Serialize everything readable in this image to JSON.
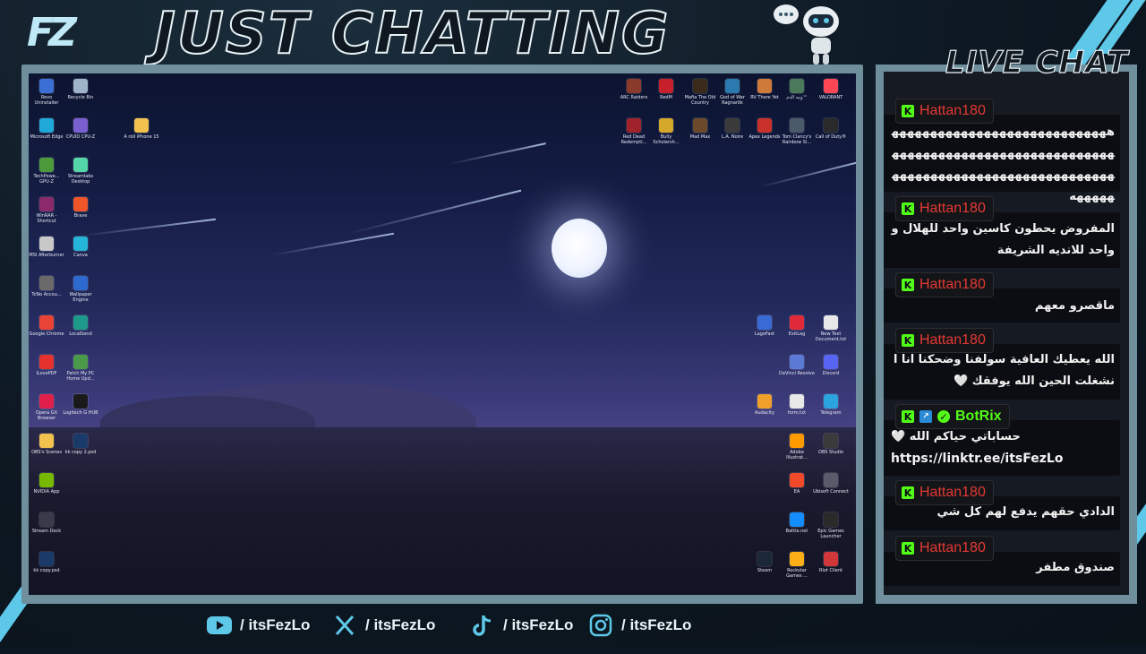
{
  "header": {
    "logo": "FZ",
    "title": "JUST CHATTING",
    "chat_title": "LIVE CHAT"
  },
  "desktop": {
    "icons": [
      {
        "label": "Revo Uninstaller",
        "color": "#3b6fd6",
        "icon": "revo-icon"
      },
      {
        "label": "Recycle Bin",
        "color": "#9fb4c8",
        "icon": "recycle-bin-icon"
      },
      {
        "label": "Microsoft Edge",
        "color": "#1fa8d8",
        "icon": "edge-icon"
      },
      {
        "label": "CPUID CPU-Z",
        "color": "#7a5fd0",
        "icon": "cpuz-icon"
      },
      {
        "label": "A roll iPhone 15",
        "color": "#f2c14e",
        "icon": "folder-icon"
      },
      {
        "label": "TechPowe... GPU-Z",
        "color": "#4c9a3a",
        "icon": "gpuz-icon"
      },
      {
        "label": "Streamlabs Desktop",
        "color": "#55d6a8",
        "icon": "streamlabs-icon"
      },
      {
        "label": "WinRAR - Shortcut",
        "color": "#8a2a6a",
        "icon": "winrar-icon"
      },
      {
        "label": "Brave",
        "color": "#f0562a",
        "icon": "brave-icon"
      },
      {
        "label": "MSI Afterburner",
        "color": "#c8c8c8",
        "icon": "msi-icon"
      },
      {
        "label": "Canva",
        "color": "#25b5d8",
        "icon": "canva-icon"
      },
      {
        "label": "TcNo Accou...",
        "color": "#6a6a6a",
        "icon": "tcno-icon"
      },
      {
        "label": "Wallpaper Engine",
        "color": "#2d6ad0",
        "icon": "wallpaper-engine-icon"
      },
      {
        "label": "Google Chrome",
        "color": "#e84335",
        "icon": "chrome-icon"
      },
      {
        "label": "LocalSend",
        "color": "#1e9a8a",
        "icon": "localsend-icon"
      },
      {
        "label": "iLovePDF",
        "color": "#e5322d",
        "icon": "ilovepdf-icon"
      },
      {
        "label": "Patch My PC Home Upd...",
        "color": "#4a9a4a",
        "icon": "patchmypc-icon"
      },
      {
        "label": "Opera GX Browser",
        "color": "#e0204a",
        "icon": "opera-gx-icon"
      },
      {
        "label": "Logitech G HUB",
        "color": "#1a1a1a",
        "icon": "logitech-icon"
      },
      {
        "label": "OBS's Scenes",
        "color": "#f2c14e",
        "icon": "folder-icon"
      },
      {
        "label": "kk copy 2.psd",
        "color": "#1a3a6a",
        "icon": "psd-icon"
      },
      {
        "label": "NVIDIA App",
        "color": "#76b900",
        "icon": "nvidia-icon"
      },
      {
        "label": "Stream Deck",
        "color": "#3a3a4a",
        "icon": "stream-deck-icon"
      },
      {
        "label": "kk copy.psd",
        "color": "#1a3a6a",
        "icon": "psd-icon"
      },
      {
        "label": "ARC Raiders",
        "color": "#8a3a2a",
        "icon": "arc-raiders-icon"
      },
      {
        "label": "RedM",
        "color": "#c8202a",
        "icon": "redm-icon"
      },
      {
        "label": "Mafia The Old Country",
        "color": "#3a2a1a",
        "icon": "mafia-icon"
      },
      {
        "label": "God of War Ragnarök",
        "color": "#2a7ab0",
        "icon": "god-of-war-icon"
      },
      {
        "label": "RV There Yet",
        "color": "#d07a3a",
        "icon": "rv-icon"
      },
      {
        "label": "ونيد الدم™",
        "color": "#4a7a5a",
        "icon": "game-icon"
      },
      {
        "label": "VALORANT",
        "color": "#ff4655",
        "icon": "valorant-icon"
      },
      {
        "label": "Red Dead Redempti...",
        "color": "#a0222a",
        "icon": "rdr-icon"
      },
      {
        "label": "Bully Scholarsh...",
        "color": "#d6a82a",
        "icon": "bully-icon"
      },
      {
        "label": "Mad Max",
        "color": "#6a4a2a",
        "icon": "mad-max-icon"
      },
      {
        "label": "L.A. Noire",
        "color": "#3a3a3a",
        "icon": "la-noire-icon"
      },
      {
        "label": "Apex Legends",
        "color": "#c8302a",
        "icon": "apex-icon"
      },
      {
        "label": "Tom Clancy's Rainbow Si...",
        "color": "#4a5a6a",
        "icon": "rainbow-six-icon"
      },
      {
        "label": "Call of Duty®",
        "color": "#2a2a2a",
        "icon": "cod-icon"
      },
      {
        "label": "LagoFast",
        "color": "#3a6ad6",
        "icon": "lagofast-icon"
      },
      {
        "label": "ExitLag",
        "color": "#e02a3a",
        "icon": "exitlag-icon"
      },
      {
        "label": "New Text Document.txt",
        "color": "#e8e8e8",
        "icon": "text-file-icon"
      },
      {
        "label": "DaVinci Resolve",
        "color": "#5a7ad6",
        "icon": "davinci-icon"
      },
      {
        "label": "Discord",
        "color": "#5865f2",
        "icon": "discord-icon"
      },
      {
        "label": "Audacity",
        "color": "#f0a02a",
        "icon": "audacity-icon"
      },
      {
        "label": "form.txt",
        "color": "#e8e8e8",
        "icon": "text-file-icon"
      },
      {
        "label": "Telegram",
        "color": "#2aa3df",
        "icon": "telegram-icon"
      },
      {
        "label": "Adobe Illustrat...",
        "color": "#ff9a00",
        "icon": "illustrator-icon"
      },
      {
        "label": "OBS Studio",
        "color": "#3a3a3a",
        "icon": "obs-icon"
      },
      {
        "label": "EA",
        "color": "#f04a2a",
        "icon": "ea-icon"
      },
      {
        "label": "Ubisoft Connect",
        "color": "#5a5a6a",
        "icon": "ubisoft-icon"
      },
      {
        "label": "Battle.net",
        "color": "#148eff",
        "icon": "battlenet-icon"
      },
      {
        "label": "Epic Games Launcher",
        "color": "#2a2a2a",
        "icon": "epic-icon"
      },
      {
        "label": "Steam",
        "color": "#1b2838",
        "icon": "steam-icon"
      },
      {
        "label": "Rockstar Games ...",
        "color": "#fcaf17",
        "icon": "rockstar-icon"
      },
      {
        "label": "Riot Client",
        "color": "#d13639",
        "icon": "riot-icon"
      }
    ]
  },
  "chat": {
    "messages": [
      {
        "user": "Hattan180",
        "user_color": "#e53935",
        "badges": [
          "kick-badge-icon"
        ],
        "text": "ههههههههههههههههههههههههههههههههههههههههههههههههههههههههههههههههههههههههههههههههههههههههههههه"
      },
      {
        "user": "Hattan180",
        "user_color": "#e53935",
        "badges": [
          "kick-badge-icon"
        ],
        "text": "المفروض يحطون كاسين واحد للهلال وواحد للانديه الشريفة"
      },
      {
        "user": "Hattan180",
        "user_color": "#e53935",
        "badges": [
          "kick-badge-icon"
        ],
        "text": "ماقصرو معهم"
      },
      {
        "user": "Hattan180",
        "user_color": "#e53935",
        "badges": [
          "kick-badge-icon"
        ],
        "text": "الله يعطيك العافية سولفنا وضحكنا انا انشغلت الحين الله يوفقك 🤍"
      },
      {
        "user": "BotRix",
        "user_color": "#53fc18",
        "badges": [
          "kick-badge-icon",
          "bot-badge-icon",
          "verified-badge-icon"
        ],
        "text": "حساباتي حياكم الله 🤍",
        "link": "https://linktr.ee/itsFezLo"
      },
      {
        "user": "Hattan180",
        "user_color": "#e53935",
        "badges": [
          "kick-badge-icon"
        ],
        "text": "الدادي حقهم يدفع لهم كل شي"
      },
      {
        "user": "Hattan180",
        "user_color": "#e53935",
        "badges": [
          "kick-badge-icon"
        ],
        "text": "صندوق مطفر"
      }
    ]
  },
  "socials": [
    {
      "platform": "youtube-icon",
      "handle": "/ itsFezLo"
    },
    {
      "platform": "x-icon",
      "handle": "/ itsFezLo"
    },
    {
      "platform": "tiktok-icon",
      "handle": "/ itsFezLo"
    },
    {
      "platform": "instagram-icon",
      "handle": "/ itsFezLo"
    }
  ],
  "colors": {
    "accent": "#5ec8e8",
    "frame": "#6f8f9c",
    "kick_green": "#53fc18"
  }
}
